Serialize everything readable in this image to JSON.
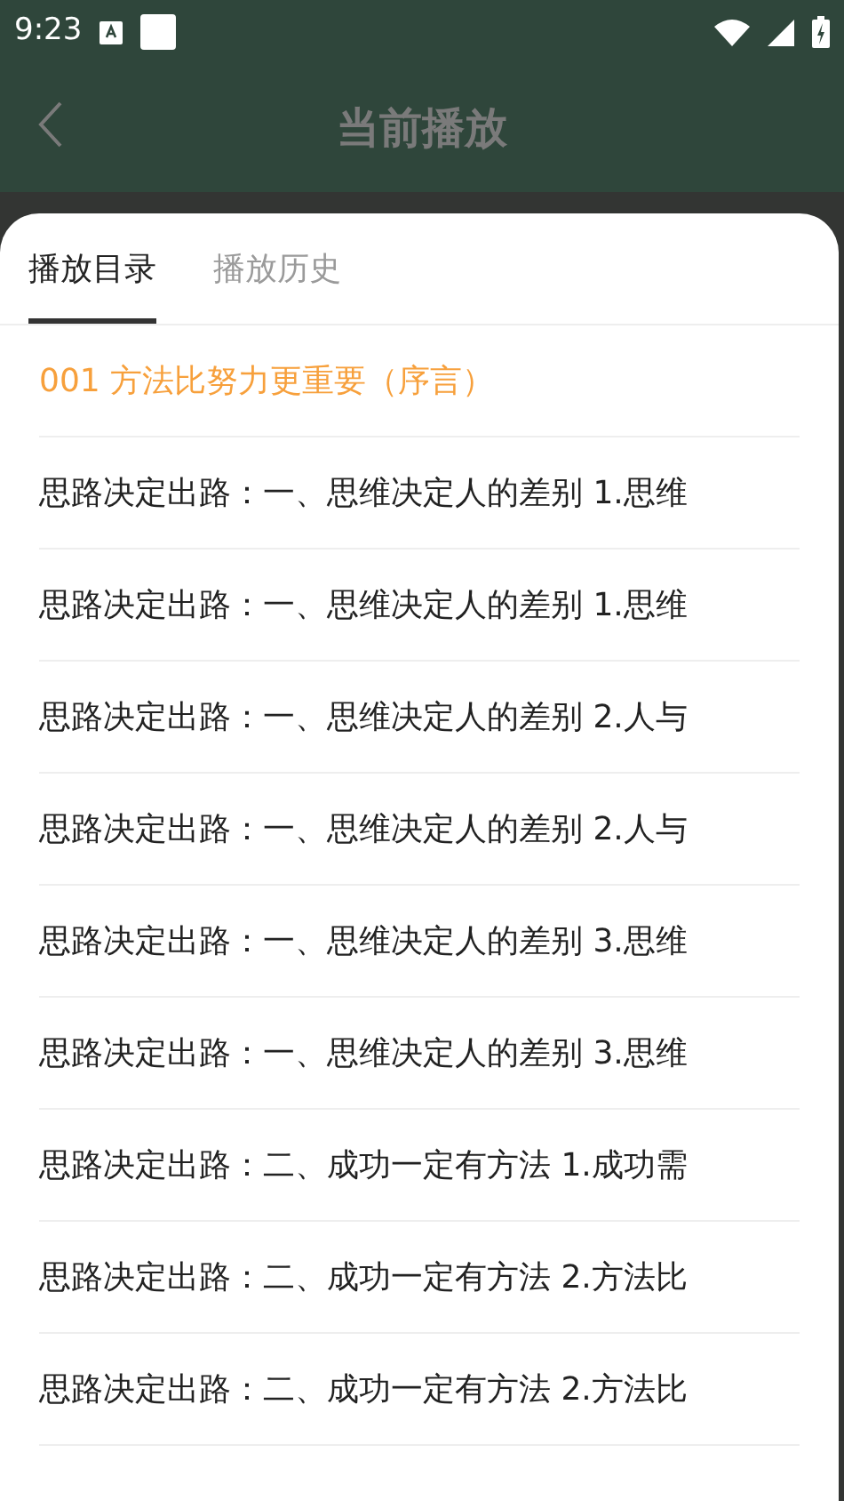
{
  "status_bar": {
    "time": "9:23"
  },
  "header": {
    "title": "当前播放"
  },
  "tabs": [
    {
      "label": "播放目录",
      "selected": true
    },
    {
      "label": "播放历史",
      "selected": false
    }
  ],
  "tracks": [
    {
      "title": "001 方法比努力更重要（序言）",
      "selected": true
    },
    {
      "title": "思路决定出路：一、思维决定人的差别 1.思维",
      "selected": false
    },
    {
      "title": "思路决定出路：一、思维决定人的差别 1.思维",
      "selected": false
    },
    {
      "title": "思路决定出路：一、思维决定人的差别 2.人与",
      "selected": false
    },
    {
      "title": "思路决定出路：一、思维决定人的差别 2.人与",
      "selected": false
    },
    {
      "title": "思路决定出路：一、思维决定人的差别 3.思维",
      "selected": false
    },
    {
      "title": "思路决定出路：一、思维决定人的差别 3.思维",
      "selected": false
    },
    {
      "title": "思路决定出路：二、成功一定有方法 1.成功需",
      "selected": false
    },
    {
      "title": "思路决定出路：二、成功一定有方法 2.方法比",
      "selected": false
    },
    {
      "title": "思路决定出路：二、成功一定有方法 2.方法比",
      "selected": false
    }
  ]
}
